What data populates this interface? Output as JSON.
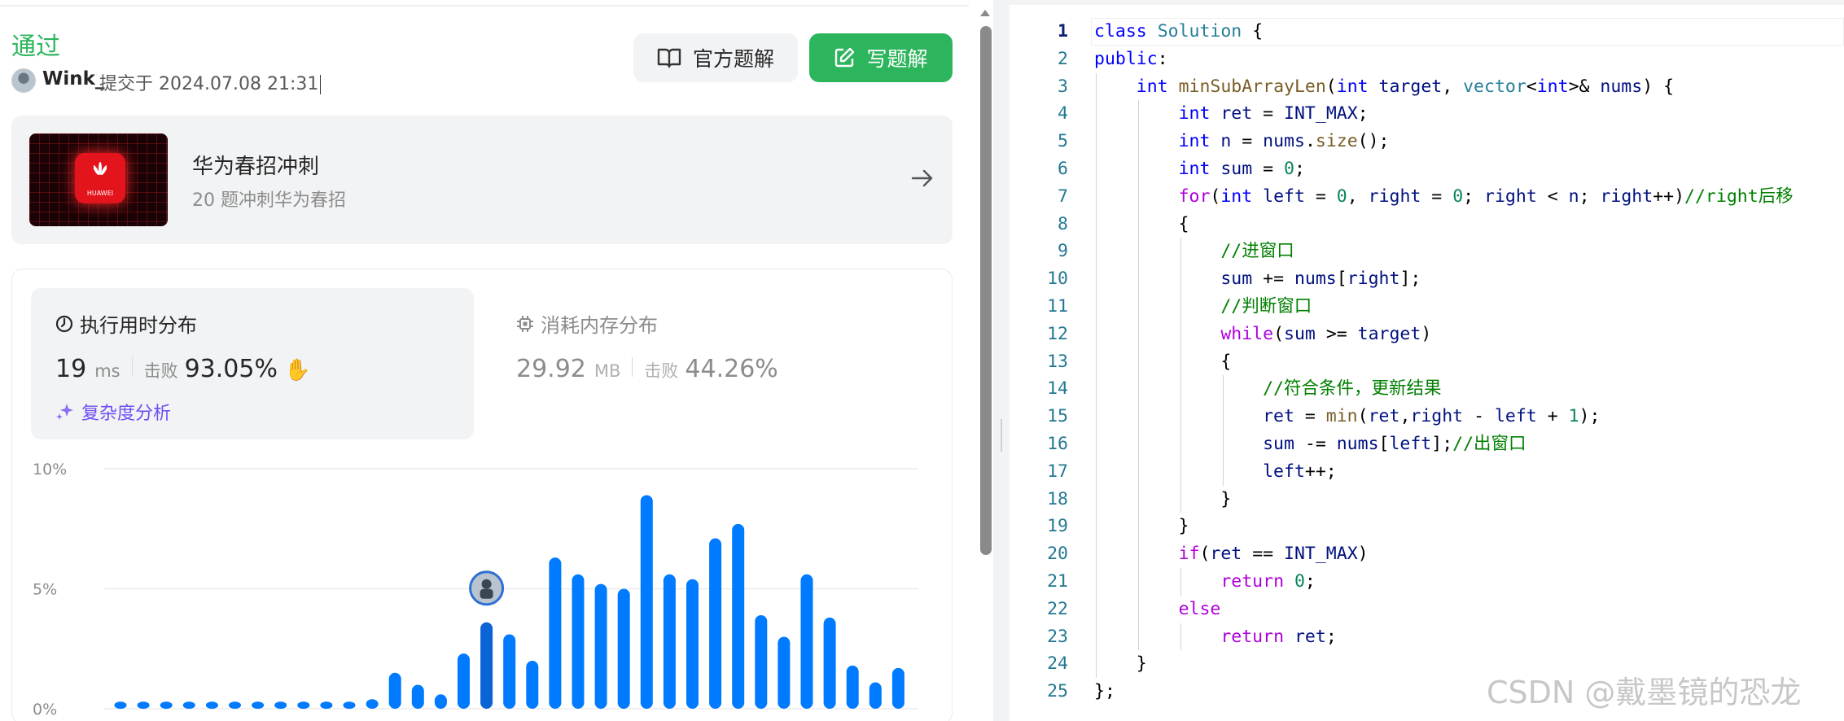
{
  "submission": {
    "status": "通过",
    "author": "Wink_",
    "submitted_text": "提交于 2024.07.08 21:31"
  },
  "actions": {
    "official_solution": "官方题解",
    "write_solution": "写题解"
  },
  "study_plan": {
    "title": "华为春招冲刺",
    "subtitle": "20 题冲刺华为春招",
    "logo_text": "HUAWEI"
  },
  "runtime": {
    "title": "执行用时分布",
    "value": "19",
    "unit": "ms",
    "beat_label": "击败",
    "beat_pct": "93.05%",
    "analysis": "复杂度分析"
  },
  "memory": {
    "title": "消耗内存分布",
    "value": "29.92",
    "unit": "MB",
    "beat_label": "击败",
    "beat_pct": "44.26%"
  },
  "chart_data": {
    "type": "bar",
    "y_ticks": [
      "10%",
      "5%",
      "0%"
    ],
    "ylim": [
      0,
      10
    ],
    "grid": true,
    "values": [
      0.3,
      0.3,
      0.3,
      0.3,
      0.3,
      0.3,
      0.3,
      0.3,
      0.3,
      0.3,
      0.3,
      0.4,
      1.5,
      1.0,
      0.6,
      2.3,
      3.6,
      3.1,
      2.0,
      6.3,
      5.6,
      5.2,
      5.0,
      8.9,
      5.6,
      5.4,
      7.1,
      7.7,
      3.9,
      3.0,
      5.6,
      3.8,
      1.8,
      1.1,
      1.7
    ],
    "user_bar_index": 16,
    "bar_color": "#007aff"
  },
  "code": {
    "active_line": 1,
    "lines": [
      "class Solution {",
      "public:",
      "    int minSubArrayLen(int target, vector<int>& nums) {",
      "        int ret = INT_MAX;",
      "        int n = nums.size();",
      "        int sum = 0;",
      "        for(int left = 0, right = 0; right < n; right++)//right后移",
      "        {",
      "            //进窗口",
      "            sum += nums[right];",
      "            //判断窗口",
      "            while(sum >= target)",
      "            {",
      "                //符合条件，更新结果",
      "                ret = min(ret,right - left + 1);",
      "                sum -= nums[left];//出窗口",
      "                left++;",
      "            }",
      "        }",
      "        if(ret == INT_MAX)",
      "            return 0;",
      "        else",
      "            return ret;",
      "    }",
      "};"
    ]
  },
  "watermark": "CSDN @戴墨镜的恐龙",
  "icons": {
    "official": "book-icon",
    "write": "edit-icon",
    "plan_arrow": "arrow-right-icon",
    "runtime": "clock-icon",
    "memory": "chip-icon",
    "analysis": "sparkle-icon",
    "clap": "clap-icon"
  }
}
